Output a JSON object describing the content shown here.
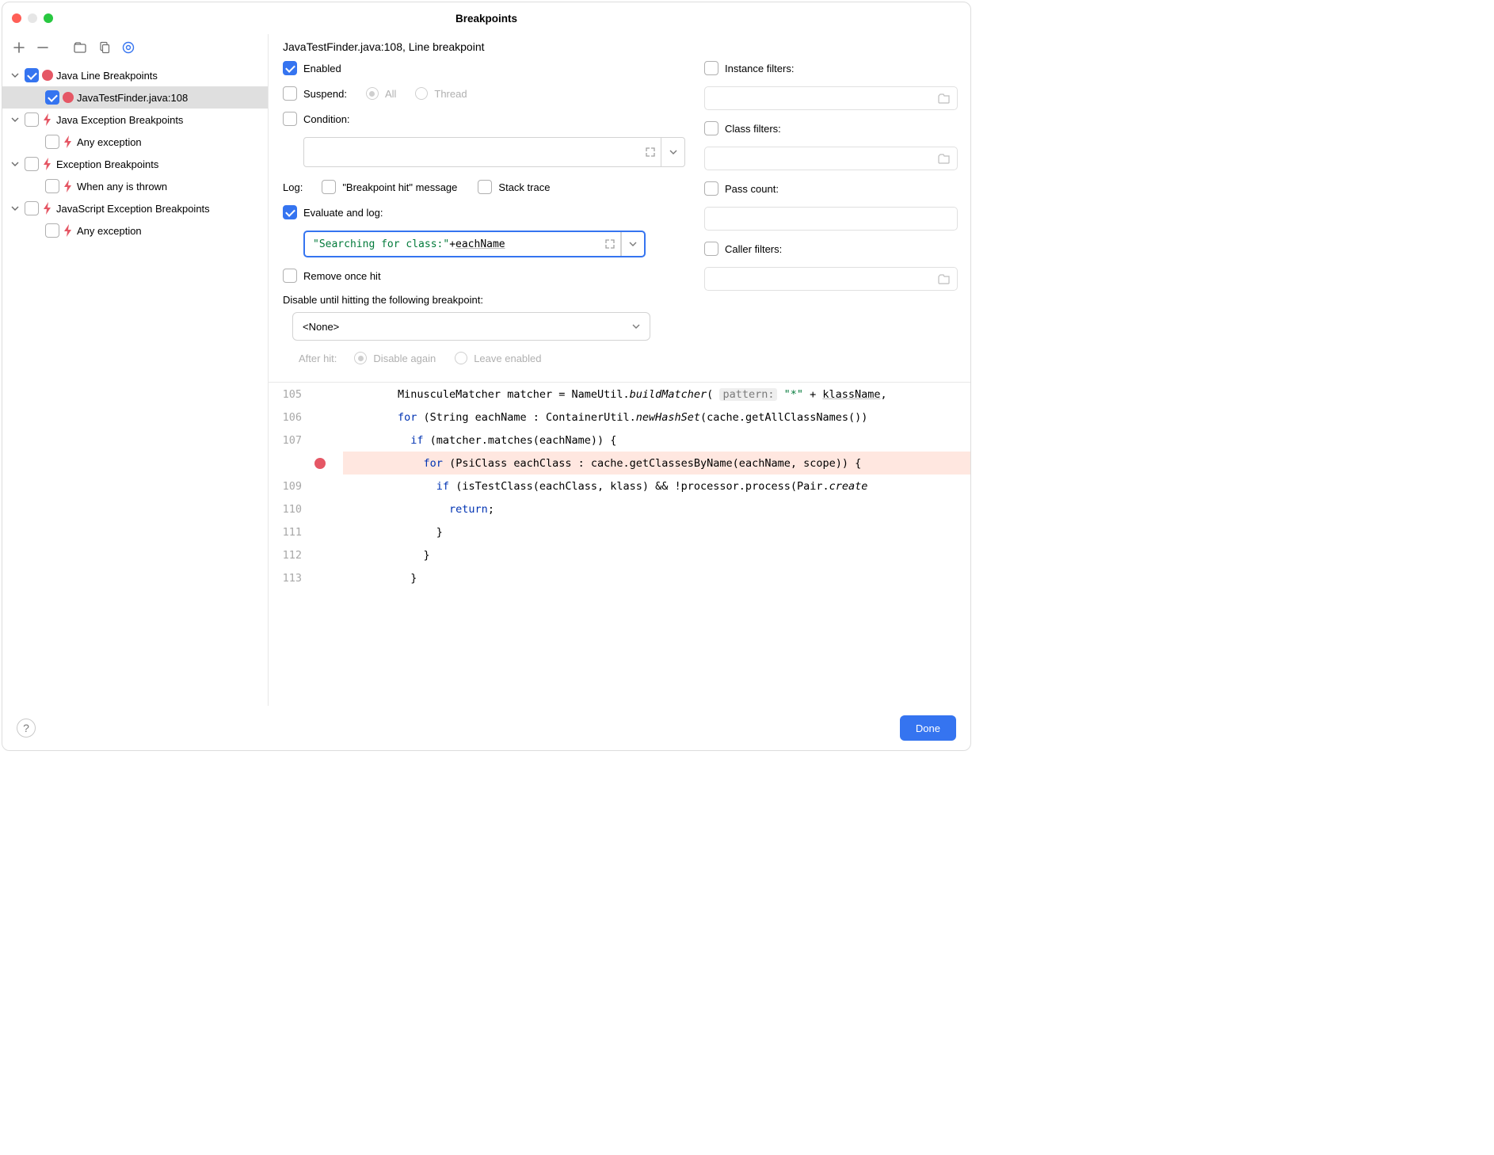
{
  "window": {
    "title": "Breakpoints"
  },
  "toolbar_icons": [
    "plus-icon",
    "minus-icon",
    "group-by-file-icon",
    "copy-icon",
    "preview-icon"
  ],
  "tree": {
    "groups": [
      {
        "label": "Java Line Breakpoints",
        "checked": true,
        "kind": "dot",
        "items": [
          {
            "label": "JavaTestFinder.java:108",
            "checked": true,
            "kind": "dot",
            "selected": true
          }
        ]
      },
      {
        "label": "Java Exception Breakpoints",
        "checked": false,
        "kind": "bolt",
        "items": [
          {
            "label": "Any exception",
            "checked": false,
            "kind": "bolt"
          }
        ]
      },
      {
        "label": "Exception Breakpoints",
        "checked": false,
        "kind": "bolt",
        "items": [
          {
            "label": "When any is thrown",
            "checked": false,
            "kind": "bolt"
          }
        ]
      },
      {
        "label": "JavaScript Exception Breakpoints",
        "checked": false,
        "kind": "bolt",
        "items": [
          {
            "label": "Any exception",
            "checked": false,
            "kind": "bolt"
          }
        ]
      }
    ]
  },
  "details": {
    "header": "JavaTestFinder.java:108, Line breakpoint",
    "enabled": {
      "label": "Enabled",
      "checked": true
    },
    "suspend": {
      "label": "Suspend:",
      "checked": false,
      "options": [
        {
          "label": "All",
          "selected": true
        },
        {
          "label": "Thread",
          "selected": false
        }
      ]
    },
    "condition": {
      "label": "Condition:",
      "checked": false,
      "value": ""
    },
    "log": {
      "label": "Log:",
      "bp_hit": {
        "label": "\"Breakpoint hit\" message",
        "checked": false
      },
      "stack": {
        "label": "Stack trace",
        "checked": false
      }
    },
    "evaluate": {
      "label": "Evaluate and log:",
      "checked": true,
      "expression_str": "\"Searching for class:\"",
      "expression_op": " + ",
      "expression_var": "eachName"
    },
    "remove_once": {
      "label": "Remove once hit",
      "checked": false
    },
    "disable_until": {
      "label": "Disable until hitting the following breakpoint:",
      "value": "<None>"
    },
    "after_hit": {
      "label": "After hit:",
      "options": [
        {
          "label": "Disable again",
          "selected": true
        },
        {
          "label": "Leave enabled",
          "selected": false
        }
      ]
    },
    "filters": {
      "instance": {
        "label": "Instance filters:",
        "checked": false
      },
      "class": {
        "label": "Class filters:",
        "checked": false
      },
      "pass": {
        "label": "Pass count:",
        "checked": false
      },
      "caller": {
        "label": "Caller filters:",
        "checked": false
      }
    }
  },
  "code": {
    "lines": [
      {
        "n": "105",
        "indent": 4,
        "html": "MinusculeMatcher matcher = NameUtil.<span class='fn-it'>buildMatcher</span>( <span class='param-hint'>pattern:</span> <span class='str'>\"*\"</span> + <span class='und'>klassName</span>,"
      },
      {
        "n": "106",
        "indent": 4,
        "html": "<span class='kw'>for</span> (String eachName : ContainerUtil.<span class='fn-it'>newHashSet</span>(cache.getAllClassNames())"
      },
      {
        "n": "107",
        "indent": 5,
        "html": "<span class='kw'>if</span> (matcher.matches(eachName)) {"
      },
      {
        "n": "",
        "indent": 6,
        "bp": true,
        "html": "<span class='kw'>for</span> (PsiClass eachClass : cache.getClassesByName(eachName, scope)) {"
      },
      {
        "n": "109",
        "indent": 7,
        "html": "<span class='kw'>if</span> (isTestClass(eachClass, klass) && !processor.process(Pair.<span class='fn-it'>create</span>"
      },
      {
        "n": "110",
        "indent": 8,
        "html": "<span class='kw'>return</span>;"
      },
      {
        "n": "111",
        "indent": 7,
        "html": "}"
      },
      {
        "n": "112",
        "indent": 6,
        "html": "}"
      },
      {
        "n": "113",
        "indent": 5,
        "html": "}"
      }
    ]
  },
  "footer": {
    "done": "Done"
  }
}
